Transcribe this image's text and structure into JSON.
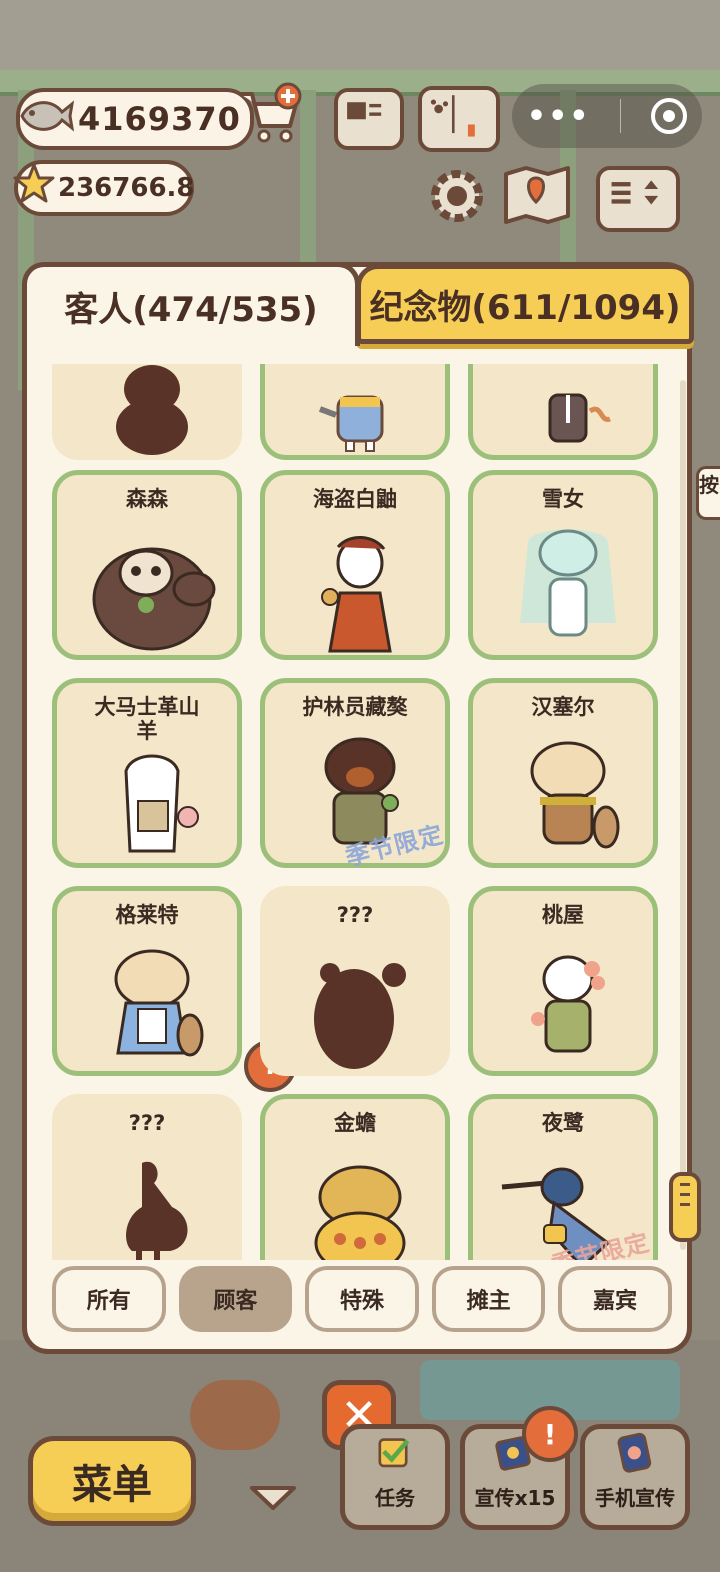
{
  "currency": {
    "fish_count": "4169370",
    "star_count": "236766.8"
  },
  "mini_program": {
    "more_label": "•••"
  },
  "tabs": {
    "guests_label": "客人(474/535)",
    "souvenirs_label": "纪念物(611/1094)"
  },
  "cards": [
    {
      "name": "",
      "state": "silhouette"
    },
    {
      "name": "",
      "state": "known"
    },
    {
      "name": "",
      "state": "known"
    },
    {
      "name": "森森",
      "state": "known"
    },
    {
      "name": "海盗白鼬",
      "state": "known"
    },
    {
      "name": "雪女",
      "state": "known"
    },
    {
      "name": "大马士革山羊",
      "state": "known",
      "alert": "!"
    },
    {
      "name": "护林员藏獒",
      "state": "known",
      "tag": "季节限定"
    },
    {
      "name": "汉塞尔",
      "state": "known"
    },
    {
      "name": "格莱特",
      "state": "known"
    },
    {
      "name": "???",
      "state": "silhouette"
    },
    {
      "name": "桃屋",
      "state": "known"
    },
    {
      "name": "???",
      "state": "silhouette"
    },
    {
      "name": "金蟾",
      "state": "known"
    },
    {
      "name": "夜鹭",
      "state": "known",
      "tag": "季节限定"
    }
  ],
  "filters": [
    {
      "label": "所有",
      "active": false
    },
    {
      "label": "顾客",
      "active": true
    },
    {
      "label": "特殊",
      "active": false
    },
    {
      "label": "摊主",
      "active": false
    },
    {
      "label": "嘉宾",
      "active": false
    }
  ],
  "close_symbol": "✕",
  "bottom": {
    "menu_label": "菜单",
    "tasks_label": "任务",
    "promo_label": "宣传x15",
    "phone_promo_label": "手机宣传",
    "alert_symbol": "!"
  },
  "side_tab_label": "按",
  "colors": {
    "border": "#6b4a3a",
    "panel": "#fbf5e8",
    "card": "#f4e6c8",
    "card_border": "#9cc07a",
    "accent_yellow": "#f6cd55",
    "alert_orange": "#e36d3b",
    "silhouette": "#5a3328"
  }
}
